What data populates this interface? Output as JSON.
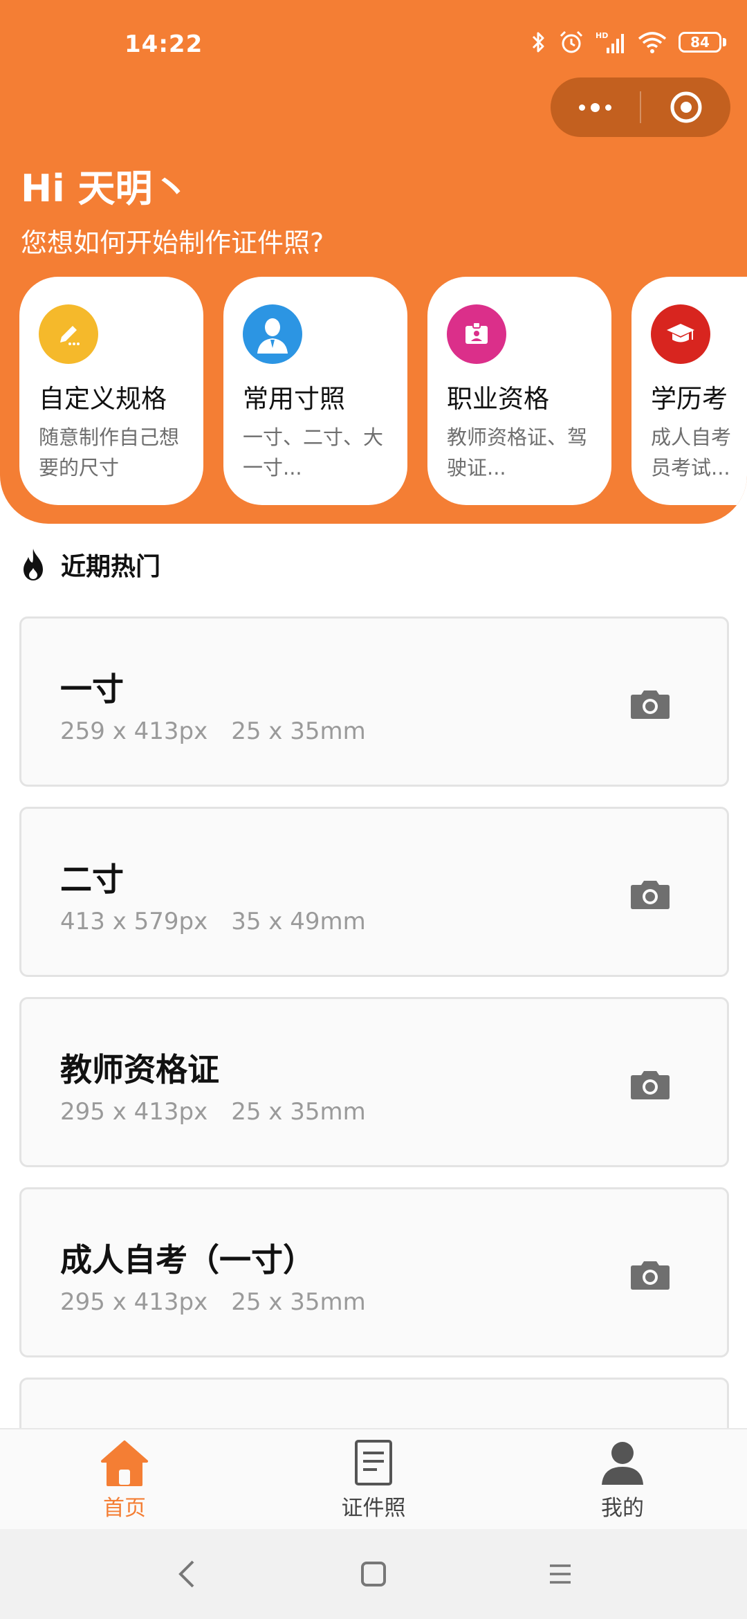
{
  "status_bar": {
    "time": "14:22",
    "battery": "84",
    "network_label": "HD"
  },
  "greeting": {
    "title": "Hi 天明丶",
    "subtitle": "您想如何开始制作证件照?"
  },
  "categories": [
    {
      "title": "自定义规格",
      "desc_line1": "随意制作自己想",
      "desc_line2": "要的尺寸",
      "icon": "pencil-icon",
      "color": "#f5b92b"
    },
    {
      "title": "常用寸照",
      "desc_line1": "一寸、二寸、大",
      "desc_line2": "一寸...",
      "icon": "person-icon",
      "color": "#2c95e3"
    },
    {
      "title": "职业资格",
      "desc_line1": "教师资格证、驾",
      "desc_line2": "驶证...",
      "icon": "badge-icon",
      "color": "#db2f8a"
    },
    {
      "title": "学历考",
      "desc_line1": "成人自考",
      "desc_line2": "员考试...",
      "icon": "graduation-cap-icon",
      "color": "#d8251f"
    }
  ],
  "section": {
    "title": "近期热门"
  },
  "popular": [
    {
      "name": "一寸",
      "px": "259 x 413px",
      "mm": "25 x 35mm"
    },
    {
      "name": "二寸",
      "px": "413 x 579px",
      "mm": "35 x 49mm"
    },
    {
      "name": "教师资格证",
      "px": "295 x 413px",
      "mm": "25 x 35mm"
    },
    {
      "name": "成人自考（一寸）",
      "px": "295 x 413px",
      "mm": "25 x 35mm"
    }
  ],
  "tabbar": {
    "home": "首页",
    "photos": "证件照",
    "mine": "我的"
  },
  "colors": {
    "accent": "#f47e34",
    "capsule": "#c3601f"
  }
}
